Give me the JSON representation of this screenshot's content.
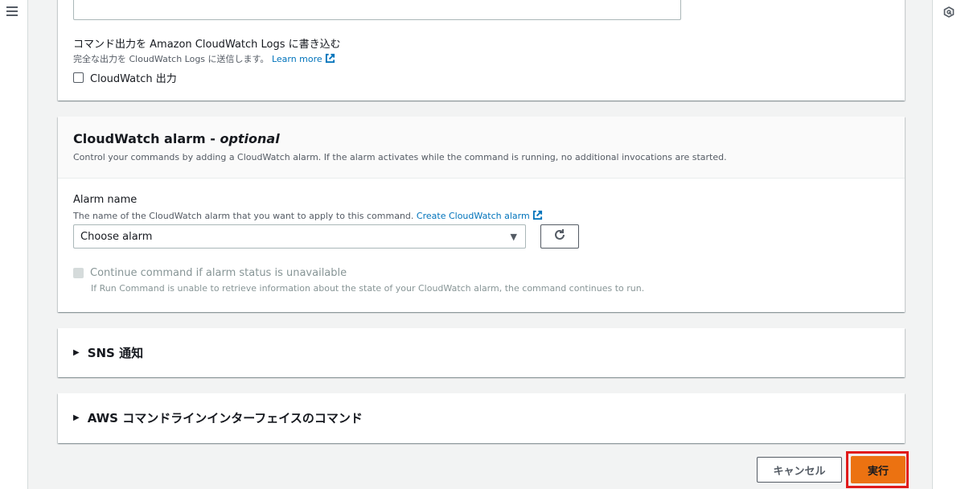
{
  "icons": {
    "hamburger": "hamburger-menu-icon",
    "rail": "settings-hexagon-icon",
    "external": "external-link-icon",
    "refresh": "refresh-icon"
  },
  "colors": {
    "link": "#0073bb",
    "primary_button": "#ec7211",
    "highlight": "#e01a1a"
  },
  "cloudwatch_logs": {
    "label": "コマンド出力を Amazon CloudWatch Logs に書き込む",
    "description": "完全な出力を CloudWatch Logs に送信します。",
    "learn_more": "Learn more",
    "checkbox_label": "CloudWatch 出力",
    "checked": false
  },
  "cloudwatch_alarm": {
    "title": "CloudWatch alarm - ",
    "title_optional": "optional",
    "description": "Control your commands by adding a CloudWatch alarm. If the alarm activates while the command is running, no additional invocations are started.",
    "alarm_name_label": "Alarm name",
    "alarm_name_description": "The name of the CloudWatch alarm that you want to apply to this command.",
    "create_alarm_link": "Create CloudWatch alarm",
    "select_value": "Choose alarm",
    "continue_label": "Continue command if alarm status is unavailable",
    "continue_description": "If Run Command is unable to retrieve information about the state of your CloudWatch alarm, the command continues to run."
  },
  "sns": {
    "title": "SNS 通知"
  },
  "cli": {
    "title": "AWS コマンドラインインターフェイスのコマンド"
  },
  "footer": {
    "cancel_label": "キャンセル",
    "run_label": "実行"
  }
}
